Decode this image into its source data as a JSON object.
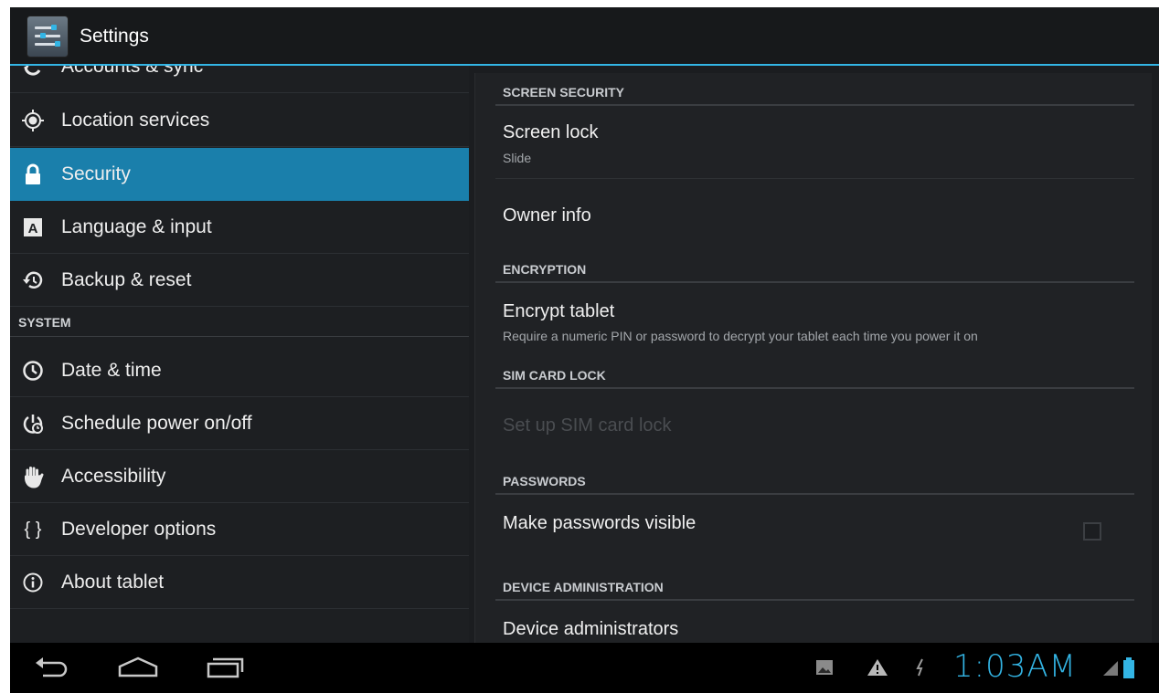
{
  "app": {
    "title": "Settings"
  },
  "colors": {
    "accent": "#33b5e5",
    "selected": "#1a7fab",
    "background": "#1b1d20"
  },
  "sidebar": {
    "items": [
      {
        "label": "Accounts & sync",
        "icon": "sync-icon"
      },
      {
        "label": "Location services",
        "icon": "location-icon"
      },
      {
        "label": "Security",
        "icon": "lock-icon",
        "selected": true
      },
      {
        "label": "Language & input",
        "icon": "keyboard-language-icon"
      },
      {
        "label": "Backup & reset",
        "icon": "backup-restore-icon"
      }
    ],
    "system_header": "SYSTEM",
    "system_items": [
      {
        "label": "Date & time",
        "icon": "clock-icon"
      },
      {
        "label": "Schedule power on/off",
        "icon": "schedule-power-icon"
      },
      {
        "label": "Accessibility",
        "icon": "hand-icon"
      },
      {
        "label": "Developer options",
        "icon": "braces-icon",
        "glyph": "{ }"
      },
      {
        "label": "About tablet",
        "icon": "info-icon"
      }
    ]
  },
  "detail": {
    "screen_security_header": "SCREEN SECURITY",
    "screen_lock": {
      "title": "Screen lock",
      "summary": "Slide"
    },
    "owner_info": {
      "title": "Owner info"
    },
    "encryption_header": "ENCRYPTION",
    "encrypt_tablet": {
      "title": "Encrypt tablet",
      "summary": "Require a numeric PIN or password to decrypt your tablet each time you power it on"
    },
    "sim_lock_header": "SIM CARD LOCK",
    "sim_lock": {
      "title": "Set up SIM card lock",
      "enabled": false
    },
    "passwords_header": "PASSWORDS",
    "make_passwords_visible": {
      "title": "Make passwords visible",
      "checked": false
    },
    "device_admin_header": "DEVICE ADMINISTRATION",
    "device_administrators": {
      "title": "Device administrators"
    }
  },
  "system_bar": {
    "time": "1:03AM",
    "nav": [
      "back-icon",
      "home-icon",
      "recent-apps-icon"
    ],
    "status": [
      "gallery-notification-icon",
      "warning-icon",
      "usb-debugging-icon",
      "signal-icon",
      "battery-icon"
    ]
  }
}
